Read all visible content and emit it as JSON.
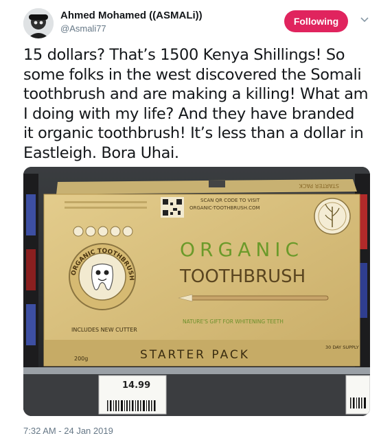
{
  "author": {
    "display_name": "Ahmed Mohamed ((ASMALi))",
    "handle": "@Asmali77"
  },
  "follow_button_label": "Following",
  "tweet": {
    "lines": [
      "15 dollars? That’s 1500 Kenya Shillings! So",
      "some folks in the west discovered the Somali",
      "toothbrush and are making a killing! What am",
      "I doing with my life? And they have branded",
      "it organic toothbrush! It’s less than a dollar in",
      "Eastleigh. Bora Uhai."
    ],
    "timestamp": "7:32 AM - 24 Jan 2019"
  },
  "photo": {
    "scan_line1": "SCAN QR CODE TO VISIT",
    "scan_line2": "ORGANIC-TOOTHBRUSH.COM",
    "brand_line1": "ORGANIC",
    "brand_line2": "TOOTHBRUSH",
    "badge_text": "ORGANIC TOOTHBRUSH",
    "includes_cutter": "INCLUDES NEW CUTTER",
    "tagline": "NATURE'S GIFT FOR WHITENING TEETH",
    "starter_pack": "STARTER PACK",
    "supply": "30 DAY SUPPLY",
    "weight": "200g",
    "price": "14.99",
    "side_text": "STARTER PACK"
  },
  "colors": {
    "follow_button": "#e0245e",
    "text_primary": "#14171a",
    "text_secondary": "#657786",
    "box_tan": "#d8c07e",
    "box_green": "#6b8f2a"
  }
}
